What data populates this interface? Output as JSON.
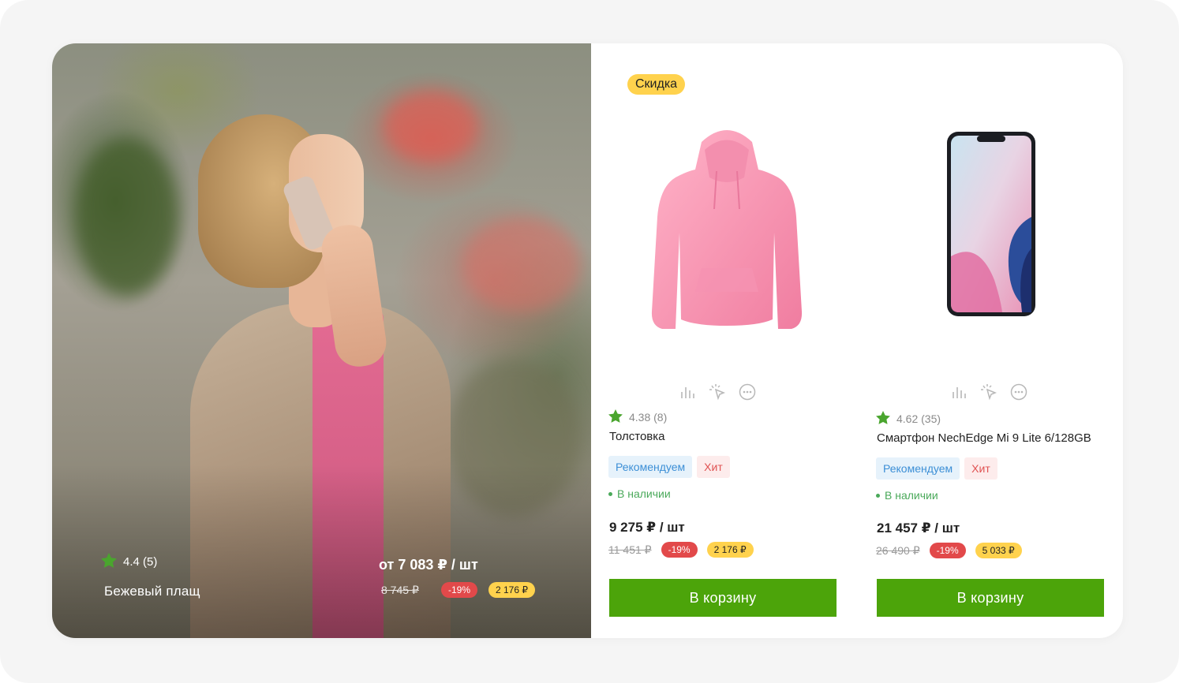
{
  "hero": {
    "rating": "4.4 (5)",
    "title": "Бежевый плащ",
    "price": "от 7 083 ₽ / шт",
    "old_price": "8 745 ₽",
    "discount": "-19%",
    "bonus": "2 176 ₽"
  },
  "products": [
    {
      "badge": "Скидка",
      "rating": "4.38 (8)",
      "title": "Толстовка",
      "tag_recommend": "Рекомендуем",
      "tag_hit": "Хит",
      "stock": "В наличии",
      "price": "9 275 ₽ / шт",
      "old_price": "11 451 ₽",
      "discount": "-19%",
      "bonus": "2 176 ₽",
      "cart": "В корзину"
    },
    {
      "rating": "4.62 (35)",
      "title": "Смартфон NechEdge Mi 9 Lite 6/128GB",
      "tag_recommend": "Рекомендуем",
      "tag_hit": "Хит",
      "stock": "В наличии",
      "price": "21 457 ₽ / шт",
      "old_price": "26 490 ₽",
      "discount": "-19%",
      "bonus": "5 033 ₽",
      "cart": "В корзину"
    }
  ],
  "colors": {
    "accent_green": "#4ca40a",
    "star_green": "#4aa52e",
    "discount_red": "#e2494a",
    "bonus_yellow": "#ffd24d"
  },
  "icons": [
    "star-icon",
    "compare-icon",
    "one-click-icon",
    "more-icon"
  ]
}
